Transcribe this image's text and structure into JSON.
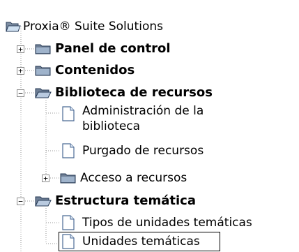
{
  "tree": {
    "root": {
      "label": "Proxia® Suite Solutions",
      "icon": "open-folder-icon"
    },
    "items": [
      {
        "label": "Panel de control",
        "level": 1,
        "type": "folder",
        "state": "collapsed"
      },
      {
        "label": "Contenidos",
        "level": 1,
        "type": "folder",
        "state": "collapsed"
      },
      {
        "label": "Biblioteca de recursos",
        "level": 1,
        "type": "folder",
        "state": "expanded"
      },
      {
        "label_line1": "Administración de la",
        "label_line2": "biblioteca",
        "level": 2,
        "type": "page"
      },
      {
        "label": "Purgado de recursos",
        "level": 2,
        "type": "page"
      },
      {
        "label": "Acceso a recursos",
        "level": 2,
        "type": "folder",
        "state": "collapsed"
      },
      {
        "label": "Estructura temática",
        "level": 1,
        "type": "folder",
        "state": "expanded"
      },
      {
        "label": "Tipos de unidades temáticas",
        "level": 2,
        "type": "page"
      },
      {
        "label": "Unidades temáticas",
        "level": 2,
        "type": "page",
        "selected": true
      }
    ],
    "expand_symbol": "+",
    "collapse_symbol": "−"
  }
}
